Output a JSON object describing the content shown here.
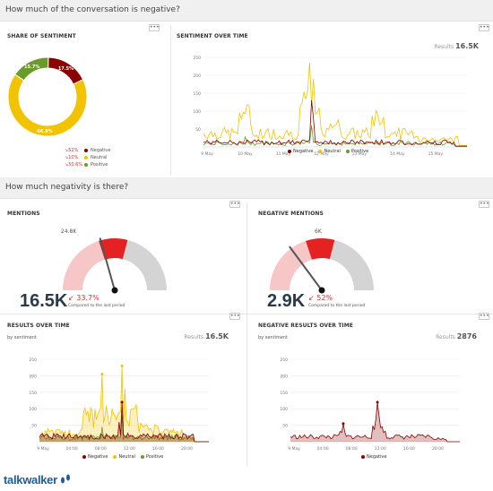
{
  "colors": {
    "negative": "#8b0000",
    "neutral": "#f2c300",
    "positive": "#6a9a2a",
    "red": "#e62121",
    "gauge_grey": "#d4d4d4",
    "gauge_pink": "#f7c7c7"
  },
  "section1": {
    "title": "How much of the conversation is negative?"
  },
  "section2": {
    "title": "How much negativity is there?"
  },
  "menu_dots": "•••",
  "share": {
    "title": "SHARE OF SENTIMENT",
    "slices": [
      {
        "name": "Negative",
        "label": "17.5%",
        "value": 17.5,
        "change": "52%",
        "dir": "down"
      },
      {
        "name": "Neutral",
        "label": "66.8%",
        "value": 66.8,
        "change": "10%",
        "dir": "down"
      },
      {
        "name": "Positive",
        "label": "15.7%",
        "value": 15.7,
        "change": "50.6%",
        "dir": "down"
      }
    ]
  },
  "over_time": {
    "title": "SENTIMENT OVER TIME",
    "results_label": "Results",
    "results_value": "16.5K",
    "yticks": [
      "250",
      "200",
      "150",
      "100",
      "50"
    ],
    "xticks": [
      "9 May",
      "10 May",
      "11 May",
      "12 May",
      "13 May",
      "14 May",
      "15 May"
    ]
  },
  "mentions": {
    "title": "MENTIONS",
    "value": "16.5K",
    "max": "24.8K",
    "change": "33.7%",
    "compared": "Compared to the last period",
    "fraction": 0.665
  },
  "neg_mentions": {
    "title": "NEGATIVE MENTIONS",
    "value": "2.9K",
    "max": "6K",
    "change": "52%",
    "compared": "Compared to the last period",
    "fraction": 0.48
  },
  "results_time": {
    "title": "RESULTS OVER TIME",
    "subtitle": "by sentiment",
    "results_label": "Results",
    "results_value": "16.5K",
    "yticks": [
      "250",
      "200",
      "150",
      "100",
      "50"
    ],
    "xticks": [
      "9 May",
      "04:00",
      "08:00",
      "12:00",
      "16:00",
      "20:00"
    ]
  },
  "neg_results_time": {
    "title": "NEGATIVE RESULTS OVER TIME",
    "subtitle": "by sentiment",
    "results_label": "Results",
    "results_value": "2876",
    "yticks": [
      "250",
      "200",
      "150",
      "100",
      "50"
    ],
    "xticks": [
      "9 May",
      "04:00",
      "08:00",
      "12:00",
      "16:00",
      "20:00"
    ]
  },
  "legend": {
    "negative": "Negative",
    "neutral": "Neutral",
    "positive": "Positive"
  },
  "logo": {
    "text": "talkwalker"
  }
}
